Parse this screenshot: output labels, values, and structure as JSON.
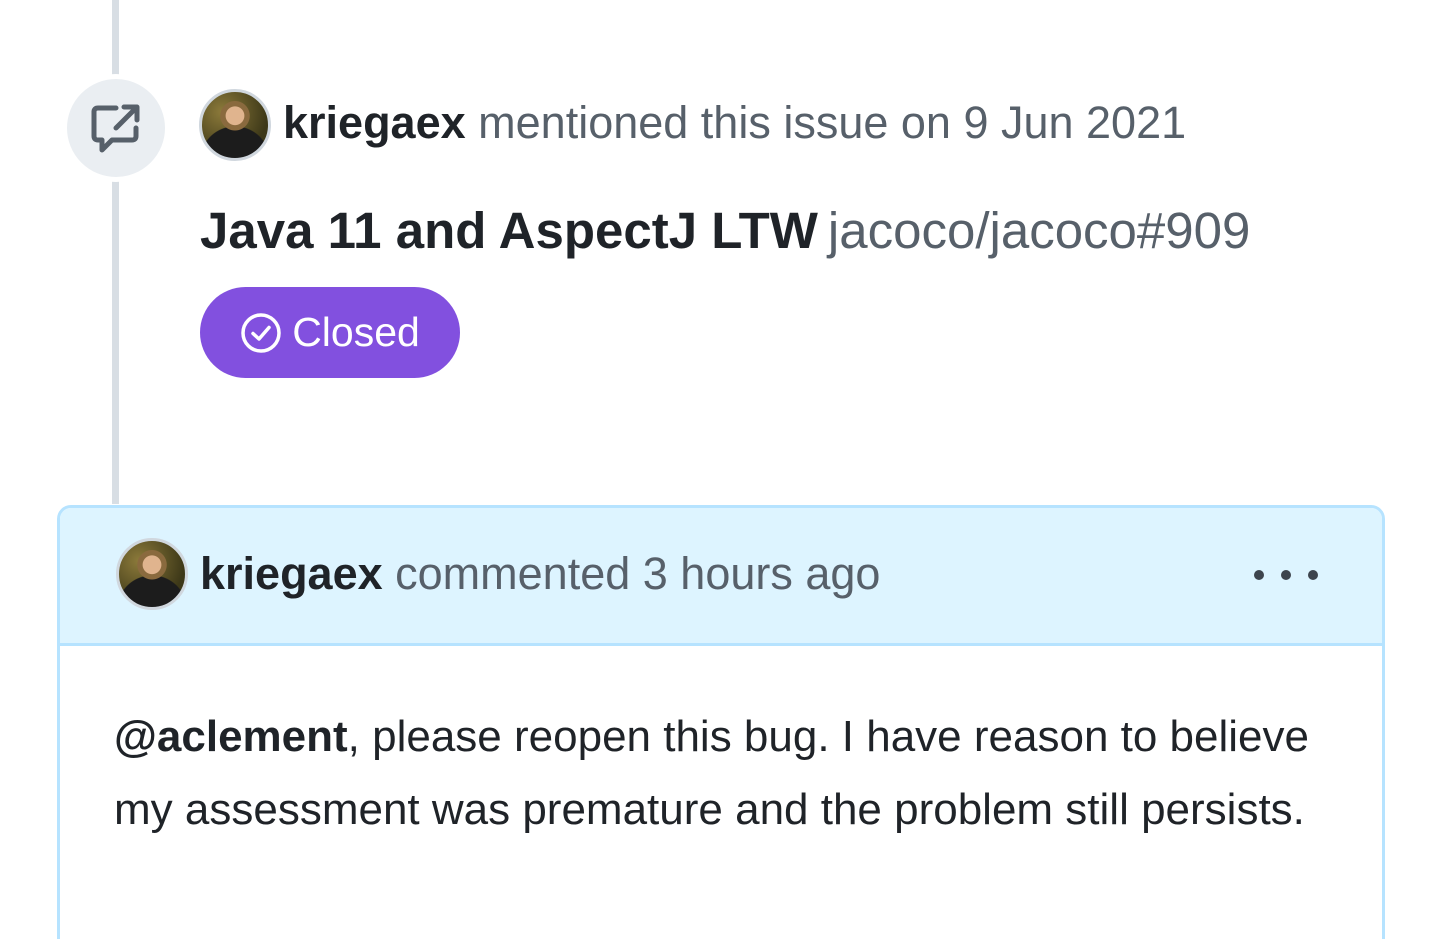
{
  "event": {
    "author": "kriegaex",
    "action_text": "mentioned this issue on 9 Jun 2021",
    "icon": "cross-reference-icon"
  },
  "reference": {
    "title": "Java 11 and AspectJ LTW",
    "ref": "jacoco/jacoco#909",
    "state_label": "Closed",
    "state_icon": "check-circle-icon",
    "state_color": "#8250df"
  },
  "comment": {
    "author": "kriegaex",
    "action_text": "commented 3 hours ago",
    "menu_icon": "kebab-horizontal-icon",
    "mention": "@aclement",
    "body_text": ", please reopen this bug. I have reason to believe my assessment was premature and the problem still persists.",
    "header_bg": "#ddf4ff",
    "border_color": "#b6e3ff"
  }
}
